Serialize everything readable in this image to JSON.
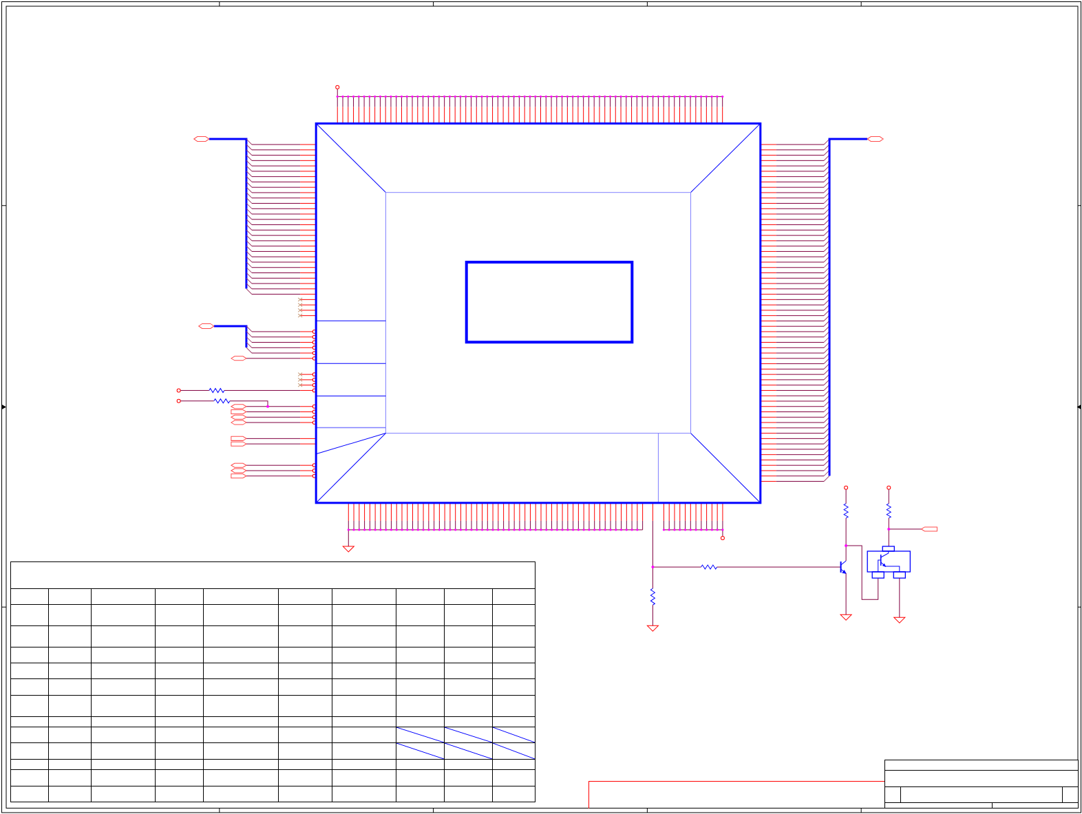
{
  "schematic": {
    "left_pin_groups": [
      {
        "pins": [
          {
            "kind": "bus",
            "ring": false
          },
          {
            "kind": "bus",
            "ring": false
          },
          {
            "kind": "bus",
            "ring": false
          },
          {
            "kind": "bus",
            "ring": false
          },
          {
            "kind": "bus",
            "ring": false
          },
          {
            "kind": "bus",
            "ring": false
          },
          {
            "kind": "bus",
            "ring": false
          },
          {
            "kind": "bus",
            "ring": false
          },
          {
            "kind": "bus",
            "ring": false
          },
          {
            "kind": "bus",
            "ring": false
          },
          {
            "kind": "bus",
            "ring": false
          },
          {
            "kind": "bus",
            "ring": false
          },
          {
            "kind": "bus",
            "ring": false
          },
          {
            "kind": "bus",
            "ring": false
          },
          {
            "kind": "bus",
            "ring": false
          },
          {
            "kind": "bus",
            "ring": false
          },
          {
            "kind": "bus",
            "ring": false
          },
          {
            "kind": "bus",
            "ring": false
          },
          {
            "kind": "bus",
            "ring": false
          },
          {
            "kind": "bus",
            "ring": false
          },
          {
            "kind": "bus",
            "ring": false
          },
          {
            "kind": "bus",
            "ring": false
          },
          {
            "kind": "bus",
            "ring": false
          },
          {
            "kind": "bus",
            "ring": false
          },
          {
            "kind": "bus",
            "ring": false
          },
          {
            "kind": "bus",
            "ring": false
          },
          {
            "kind": "bus",
            "ring": false
          },
          {
            "kind": "bus",
            "ring": false
          },
          {
            "kind": "bus",
            "ring": false
          },
          {
            "kind": "no_connect",
            "ring": false
          },
          {
            "kind": "no_connect",
            "ring": false
          },
          {
            "kind": "no_connect",
            "ring": false
          },
          {
            "kind": "no_connect",
            "ring": false
          }
        ]
      },
      {
        "pins": [
          {
            "kind": "bus",
            "ring": true
          },
          {
            "kind": "bus",
            "ring": true
          },
          {
            "kind": "bus",
            "ring": true
          },
          {
            "kind": "bus",
            "ring": true
          },
          {
            "kind": "bus",
            "ring": true
          },
          {
            "kind": "hex_port",
            "ring": true
          }
        ]
      },
      {
        "pins": [
          {
            "kind": "no_connect",
            "ring": true
          },
          {
            "kind": "no_connect",
            "ring": true
          },
          {
            "kind": "no_connect",
            "ring": true
          },
          {
            "kind": "resistor",
            "ring": true
          }
        ]
      },
      {
        "pins": [
          {
            "kind": "pullup_hex_port",
            "ring": true
          },
          {
            "kind": "flag_port",
            "ring": true
          },
          {
            "kind": "hex_port",
            "ring": true
          },
          {
            "kind": "hex_port",
            "ring": true
          }
        ]
      },
      {
        "pins": [
          {
            "kind": "flag_port",
            "ring": false
          },
          {
            "kind": "flag_port",
            "ring": false
          }
        ]
      },
      {
        "pins": [
          {
            "kind": "hex_port",
            "ring": true
          },
          {
            "kind": "hex_port",
            "ring": true
          },
          {
            "kind": "flag_port",
            "ring": true
          }
        ]
      }
    ]
  },
  "revision_table": {
    "rows": [
      {
        "cells": [
          {
            "struck": false
          },
          {
            "struck": false
          },
          {
            "struck": false
          },
          {
            "struck": false
          },
          {
            "struck": false
          },
          {
            "struck": false
          },
          {
            "struck": false
          },
          {
            "struck": false
          },
          {
            "struck": false
          },
          {
            "struck": false
          }
        ]
      },
      {
        "cells": [
          {
            "struck": false
          },
          {
            "struck": false
          },
          {
            "struck": false
          },
          {
            "struck": false
          },
          {
            "struck": false
          },
          {
            "struck": false
          },
          {
            "struck": false
          },
          {
            "struck": false
          },
          {
            "struck": false
          },
          {
            "struck": false
          }
        ]
      },
      {
        "cells": [
          {
            "struck": false
          },
          {
            "struck": false
          },
          {
            "struck": false
          },
          {
            "struck": false
          },
          {
            "struck": false
          },
          {
            "struck": false
          },
          {
            "struck": false
          },
          {
            "struck": false
          },
          {
            "struck": false
          },
          {
            "struck": false
          }
        ]
      },
      {
        "cells": [
          {
            "struck": false
          },
          {
            "struck": false
          },
          {
            "struck": false
          },
          {
            "struck": false
          },
          {
            "struck": false
          },
          {
            "struck": false
          },
          {
            "struck": false
          },
          {
            "struck": false
          },
          {
            "struck": false
          },
          {
            "struck": false
          }
        ]
      },
      {
        "cells": [
          {
            "struck": false
          },
          {
            "struck": false
          },
          {
            "struck": false
          },
          {
            "struck": false
          },
          {
            "struck": false
          },
          {
            "struck": false
          },
          {
            "struck": false
          },
          {
            "struck": false
          },
          {
            "struck": false
          },
          {
            "struck": false
          }
        ]
      },
      {
        "cells": [
          {
            "struck": false
          },
          {
            "struck": false
          },
          {
            "struck": false
          },
          {
            "struck": false
          },
          {
            "struck": false
          },
          {
            "struck": false
          },
          {
            "struck": false
          },
          {
            "struck": false
          },
          {
            "struck": false
          },
          {
            "struck": false
          }
        ]
      },
      {
        "cells": [
          {
            "struck": false
          },
          {
            "struck": false
          },
          {
            "struck": false
          },
          {
            "struck": false
          },
          {
            "struck": false
          },
          {
            "struck": false
          },
          {
            "struck": false
          },
          {
            "struck": false
          },
          {
            "struck": false
          },
          {
            "struck": false
          }
        ]
      },
      {
        "cells": [
          {
            "struck": false
          },
          {
            "struck": false
          },
          {
            "struck": false
          },
          {
            "struck": false
          },
          {
            "struck": false
          },
          {
            "struck": false
          },
          {
            "struck": false
          },
          {
            "struck": false
          },
          {
            "struck": false
          },
          {
            "struck": false
          }
        ]
      },
      {
        "cells": [
          {
            "struck": false
          },
          {
            "struck": false
          },
          {
            "struck": false
          },
          {
            "struck": false
          },
          {
            "struck": false
          },
          {
            "struck": false
          },
          {
            "struck": false
          },
          {
            "struck": true
          },
          {
            "struck": true
          },
          {
            "struck": true
          }
        ]
      },
      {
        "cells": [
          {
            "struck": false
          },
          {
            "struck": false
          },
          {
            "struck": false
          },
          {
            "struck": false
          },
          {
            "struck": false
          },
          {
            "struck": false
          },
          {
            "struck": false
          },
          {
            "struck": true
          },
          {
            "struck": true
          },
          {
            "struck": true
          }
        ]
      },
      {
        "cells": [
          {
            "struck": false
          },
          {
            "struck": false
          },
          {
            "struck": false
          },
          {
            "struck": false
          },
          {
            "struck": false
          },
          {
            "struck": false
          },
          {
            "struck": false
          },
          {
            "struck": false
          },
          {
            "struck": false
          },
          {
            "struck": false
          }
        ]
      },
      {
        "cells": [
          {
            "struck": false
          },
          {
            "struck": false
          },
          {
            "struck": false
          },
          {
            "struck": false
          },
          {
            "struck": false
          },
          {
            "struck": false
          },
          {
            "struck": false
          },
          {
            "struck": false
          },
          {
            "struck": false
          },
          {
            "struck": false
          }
        ]
      },
      {
        "cells": [
          {
            "struck": false
          },
          {
            "struck": false
          },
          {
            "struck": false
          },
          {
            "struck": false
          },
          {
            "struck": false
          },
          {
            "struck": false
          },
          {
            "struck": false
          },
          {
            "struck": false
          },
          {
            "struck": false
          },
          {
            "struck": false
          }
        ]
      }
    ]
  }
}
